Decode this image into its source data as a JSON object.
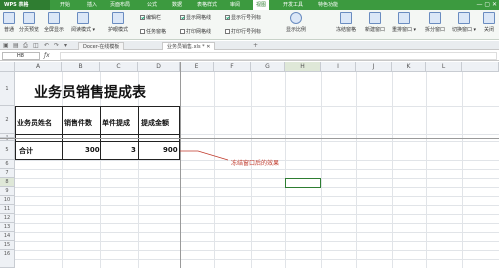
{
  "menubar": {
    "app": "WPS 表格",
    "items": [
      "开始",
      "插入",
      "页面布局",
      "公式",
      "数据",
      "表格样式",
      "审阅",
      "视图",
      "开发工具",
      "特色功能"
    ],
    "active": "视图"
  },
  "ribbon": {
    "buttons": [
      "普通",
      "分页预览",
      "全屏显示",
      "阅读模式",
      "护眼模式",
      "显示比例",
      "冻结窗格",
      "新建窗口",
      "重排窗口",
      "拆分窗口",
      "切换窗口",
      "关闭"
    ],
    "checks": [
      {
        "label": "编辑栏",
        "checked": true
      },
      {
        "label": "任务窗格",
        "checked": false
      },
      {
        "label": "显示网格线",
        "checked": true
      },
      {
        "label": "打印网格线",
        "checked": false
      },
      {
        "label": "显示行号列标",
        "checked": true
      },
      {
        "label": "打印行号列标",
        "checked": false
      }
    ]
  },
  "tabs": [
    {
      "label": "Docer-在线模板",
      "active": false
    },
    {
      "label": "业务员销售.xls *",
      "active": true
    }
  ],
  "formulabar": {
    "cell": "H8"
  },
  "sheet": {
    "columns": [
      "A",
      "B",
      "C",
      "D",
      "E",
      "F",
      "G",
      "H",
      "I",
      "J",
      "K",
      "L"
    ],
    "rows": [
      "1",
      "2",
      "3",
      "4",
      "5",
      "6",
      "7",
      "8",
      "9",
      "10",
      "11",
      "12",
      "13",
      "14",
      "15",
      "16"
    ],
    "title": "业务员销售提成表",
    "headers": [
      "业务员姓名",
      "销售件数",
      "单件提成",
      "提成金额"
    ],
    "total_label": "合计",
    "total_values": [
      "300",
      "3",
      "900"
    ]
  },
  "annotation": "冻结窗口后的效果"
}
